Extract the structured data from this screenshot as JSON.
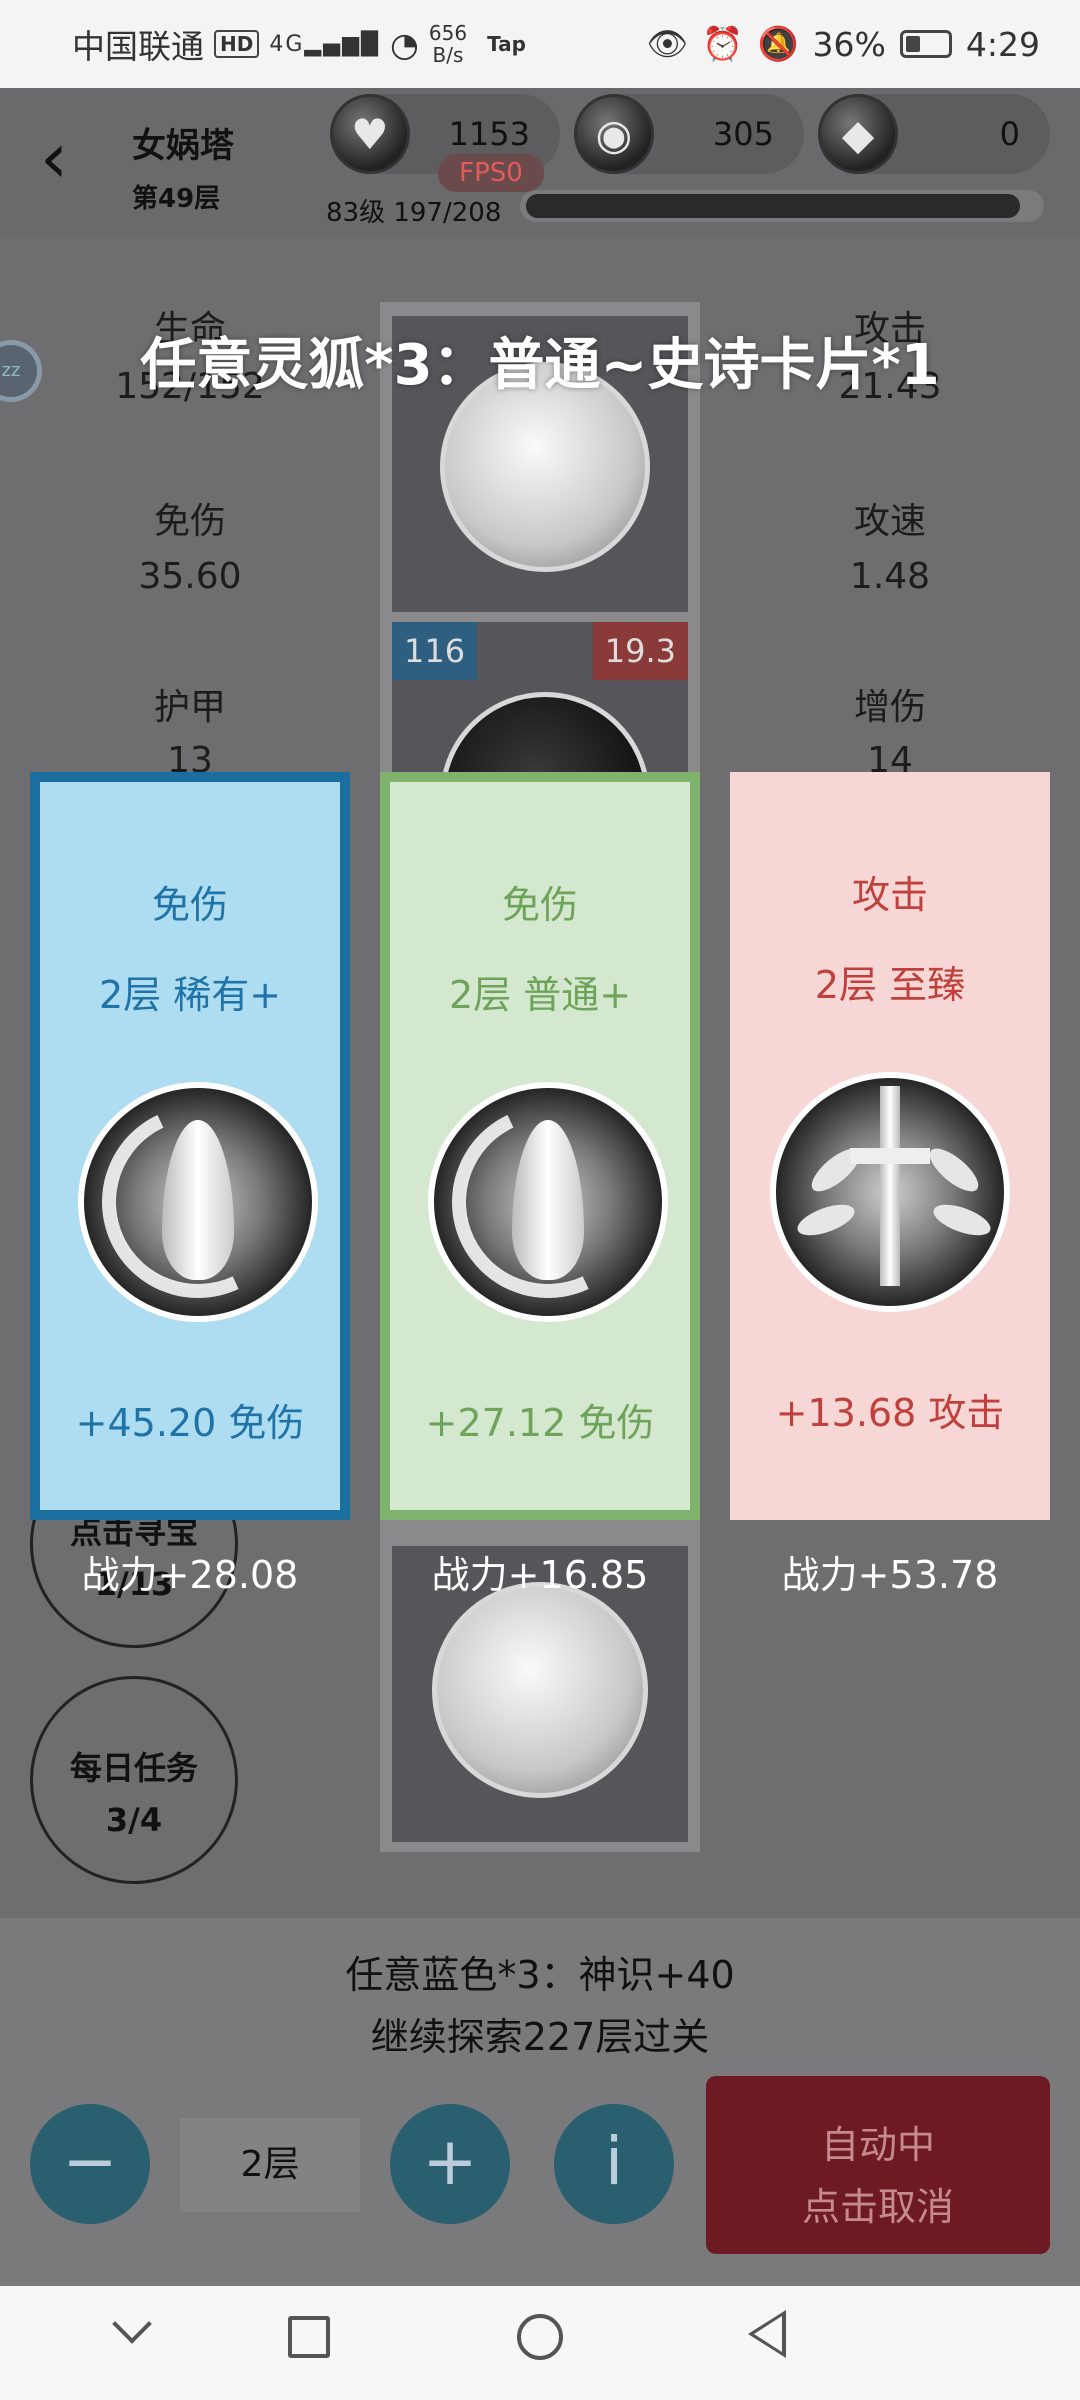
{
  "status_bar": {
    "carrier": "中国联通",
    "hd": "HD",
    "network": "4G",
    "speed_value": "656",
    "speed_unit": "B/s",
    "tap": "Tap",
    "battery": "36%",
    "battery_level": 0.36,
    "time": "4:29"
  },
  "header": {
    "tower_name": "女娲塔",
    "floor": "第49层",
    "hearts": "1153",
    "coins": "305",
    "diamonds": "0",
    "fps": "FPS0",
    "level_text": "83级 197/208",
    "xp_fraction": 0.947
  },
  "stats": {
    "life_label": "生命",
    "life_value": "152/152",
    "attack_label": "攻击",
    "attack_value": "21.43",
    "dmg_reduce_label": "免伤",
    "dmg_reduce_value": "35.60",
    "atk_speed_label": "攻速",
    "atk_speed_value": "1.48",
    "armor_label": "护甲",
    "armor_value": "13",
    "dmg_inc_label": "增伤",
    "dmg_inc_value": "14"
  },
  "side_avatar": "zz",
  "card_badges": {
    "left": "116",
    "right": "19.3"
  },
  "headline": "任意灵狐*3：普通~史诗卡片*1",
  "choices": [
    {
      "title": "免伤",
      "sub": "2层 稀有+",
      "bonus": "+45.20 免伤",
      "power": "战力+28.08",
      "accent": "#1a6f9e",
      "icon": "water-drop-emblem-icon"
    },
    {
      "title": "免伤",
      "sub": "2层 普通+",
      "bonus": "+27.12 免伤",
      "power": "战力+16.85",
      "accent": "#7fb26c",
      "icon": "water-drop-emblem-icon"
    },
    {
      "title": "攻击",
      "sub": "2层 至臻",
      "bonus": "+13.68 攻击",
      "power": "战力+53.78",
      "accent": "#c0413c",
      "icon": "sword-emblem-icon"
    }
  ],
  "round_buttons": {
    "treasure_l1": "点击寻宝",
    "treasure_l2": "1/13",
    "daily_l1": "每日任务",
    "daily_l2": "3/4"
  },
  "bottom": {
    "line1": "任意蓝色*3：神识+40",
    "line2": "继续探索227层过关",
    "minus": "−",
    "floor_value": "2层",
    "plus": "+",
    "info": "i",
    "auto_line1": "自动中",
    "auto_line2": "点击取消"
  }
}
